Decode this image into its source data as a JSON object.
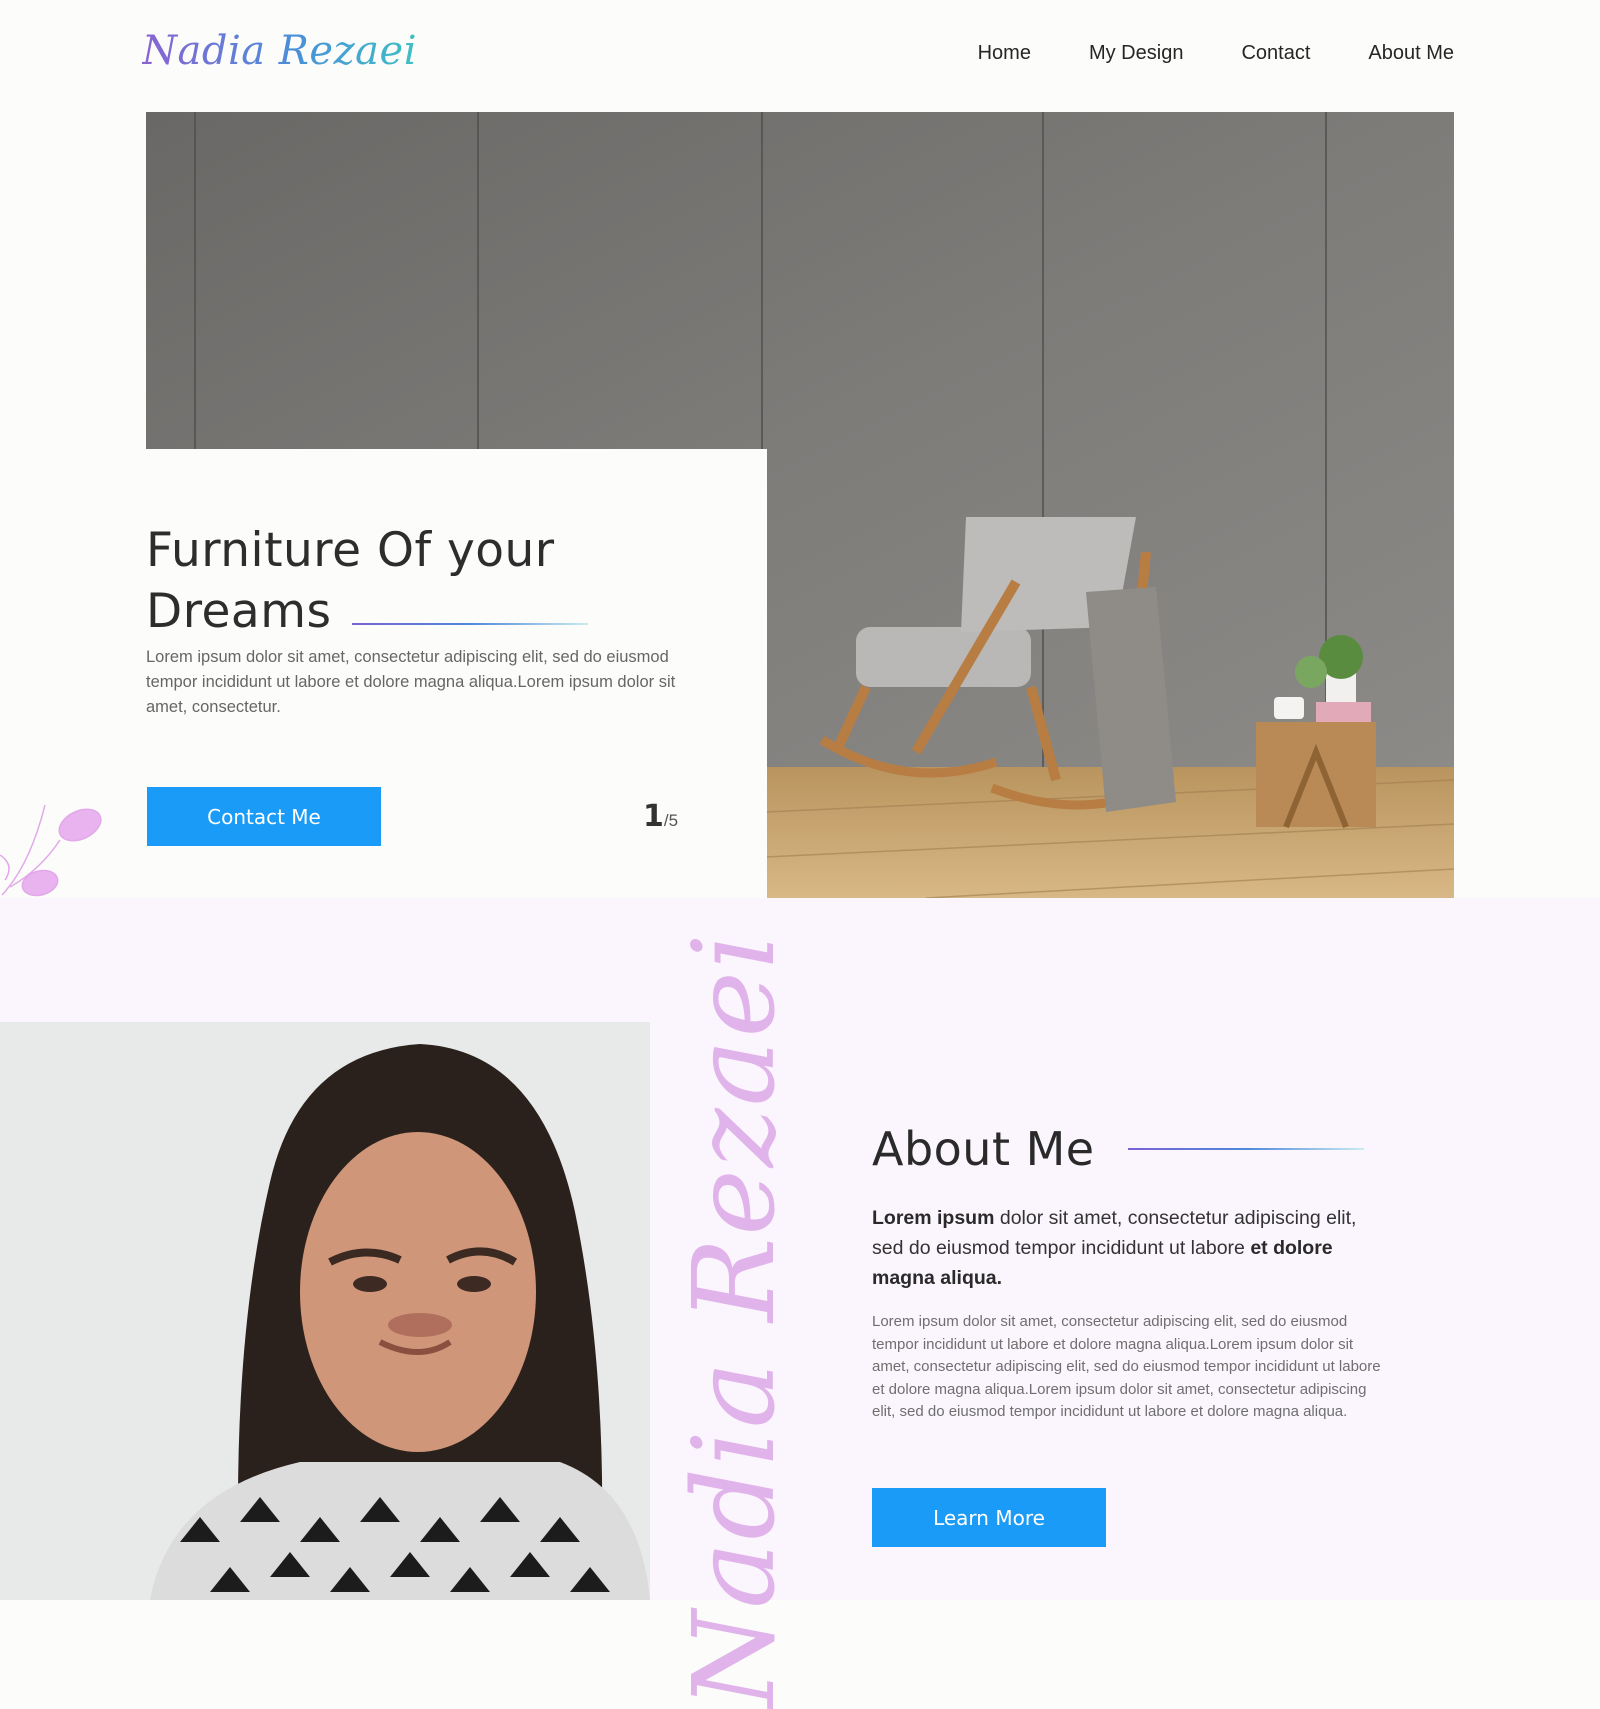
{
  "header": {
    "logo": "Nadia Rezaei",
    "nav": [
      "Home",
      "My Design",
      "Contact",
      "About Me"
    ]
  },
  "hero": {
    "title": "Furniture Of your Dreams",
    "description": "Lorem ipsum dolor sit amet, consectetur adipiscing elit, sed do eiusmod tempor incididunt ut labore et dolore magna aliqua.Lorem ipsum dolor sit amet, consectetur.",
    "cta_label": "Contact Me",
    "slide_current": "1",
    "slide_total": "/5"
  },
  "about": {
    "title": "About Me",
    "vertical_name": "Nadia Rezaei",
    "lead": {
      "bold_start": "Lorem ipsum",
      "middle": " dolor sit amet, consectetur adipiscing elit, sed do eiusmod tempor incididunt ut labore ",
      "bold_end": "et dolore magna aliqua."
    },
    "body": "Lorem ipsum dolor sit amet, consectetur adipiscing elit, sed do eiusmod tempor incididunt ut labore et dolore magna aliqua.Lorem ipsum dolor sit amet, consectetur adipiscing elit, sed do eiusmod tempor incididunt ut labore et dolore magna aliqua.Lorem ipsum dolor sit amet, consectetur adipiscing elit, sed do eiusmod tempor incididunt ut labore et dolore magna aliqua.",
    "cta_label": "Learn More"
  },
  "colors": {
    "accent": "#1b9bf8",
    "about_background": "#fbf5fd",
    "script_name": "#e0b4ea",
    "logo_gradient": [
      "#8a63d2",
      "#4a8fd9",
      "#3fc0c4"
    ]
  }
}
